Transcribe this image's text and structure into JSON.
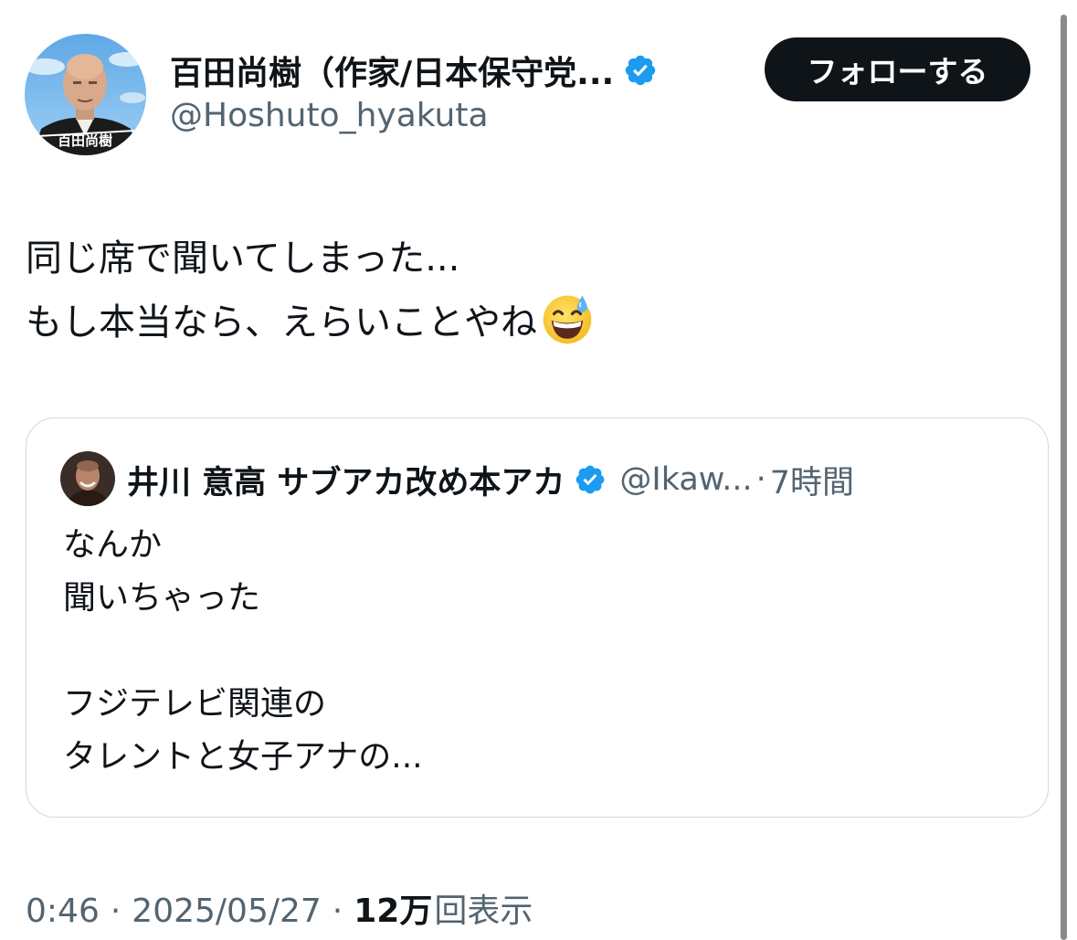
{
  "author": {
    "display_name": "百田尚樹（作家/日本保守党...",
    "handle": "@Hoshuto_hyakuta",
    "avatar_caption": "百田尚樹",
    "verified_icon": "verified-badge-icon"
  },
  "follow_button": {
    "label": "フォローする"
  },
  "tweet": {
    "line1": "同じ席で聞いてしまった...",
    "line2": "もし本当なら、えらいことやね",
    "emoji": "grinning-face-with-sweat-emoji"
  },
  "quote": {
    "display_name": "井川 意高 サブアカ改め本アカ",
    "handle": "@Ikaw...",
    "dot": "·",
    "time": "7時間",
    "lines": [
      "なんか",
      "聞いちゃった",
      "",
      "フジテレビ関連の",
      "タレントと女子アナの..."
    ]
  },
  "meta": {
    "time": "0:46",
    "separator": "·",
    "date": "2025/05/27",
    "views_count": "12万",
    "views_label": "回表示"
  },
  "colors": {
    "text_primary": "#0f1419",
    "text_secondary": "#536471",
    "verified_blue": "#1d9bf0",
    "button_bg": "#0f1419",
    "card_border": "#cfd9de"
  }
}
